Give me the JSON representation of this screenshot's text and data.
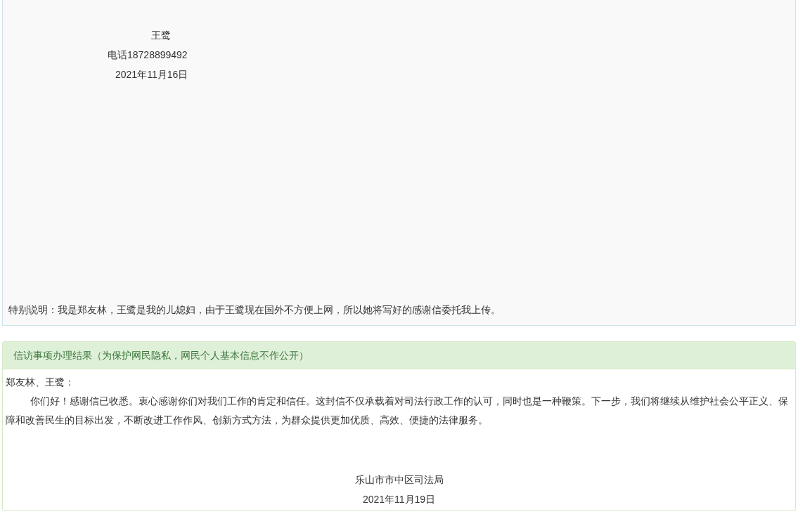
{
  "letter": {
    "signature": {
      "name": "王鹭",
      "phone": "电话18728899492",
      "date": "2021年11月16日"
    },
    "note": "特别说明：我是郑友林，王鹭是我的儿媳妇，由于王鹭现在国外不方便上网，所以她将写好的感谢信委托我上传。"
  },
  "result": {
    "title": "信访事项办理结果（为保护网民隐私，网民个人基本信息不作公开）",
    "salutation": "郑友林、王鹭：",
    "body": "你们好！感谢信已收悉。衷心感谢你们对我们工作的肯定和信任。这封信不仅承载着对司法行政工作的认可，同时也是一种鞭策。下一步，我们将继续从维护社会公平正义、保障和改善民生的目标出发，不断改进工作作风、创新方式方法，为群众提供更加优质、高效、便捷的法律服务。",
    "organization": "乐山市市中区司法局",
    "date": "2021年11月19日"
  }
}
